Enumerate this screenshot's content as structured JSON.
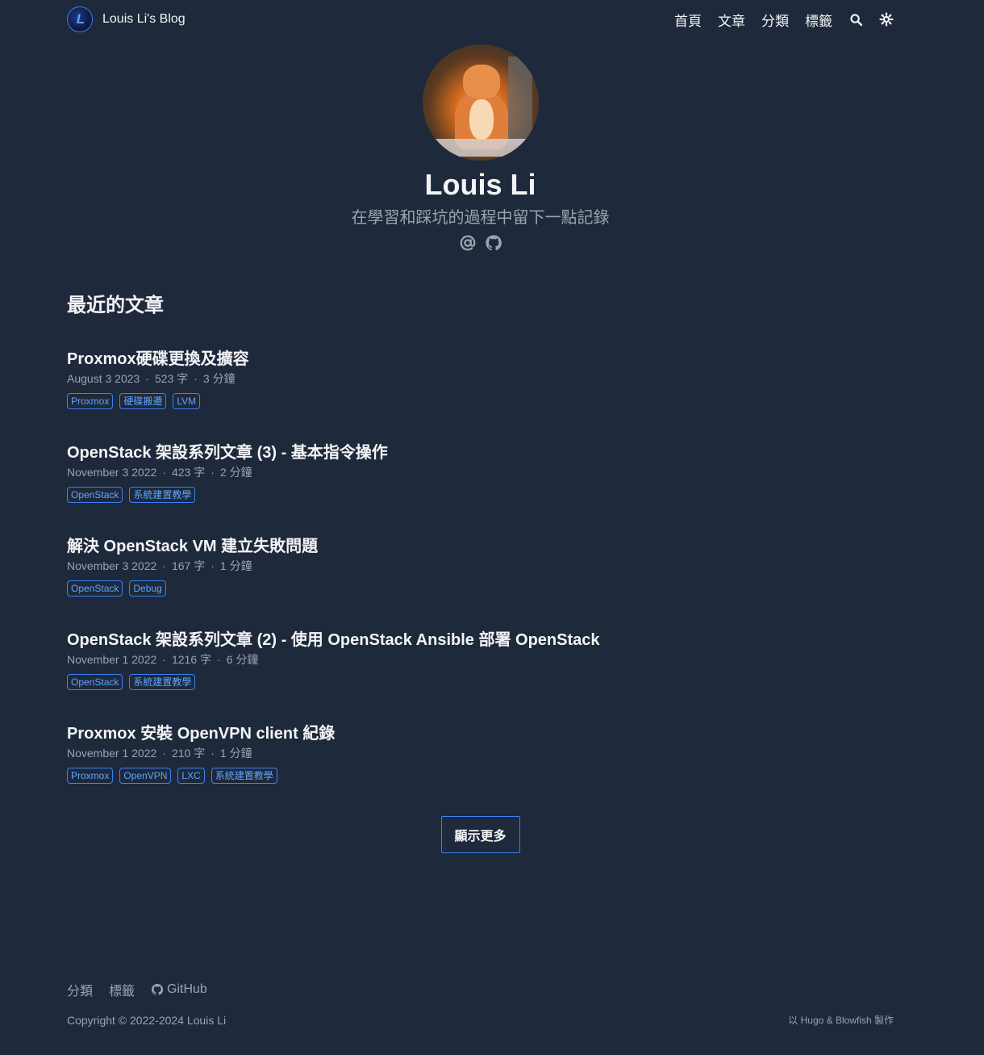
{
  "header": {
    "site_title": "Louis Li's Blog",
    "logo_text": "L",
    "nav": [
      {
        "label": "首頁"
      },
      {
        "label": "文章"
      },
      {
        "label": "分類"
      },
      {
        "label": "標籤"
      }
    ],
    "icons": [
      "search-icon",
      "theme-toggle-icon"
    ]
  },
  "profile": {
    "name": "Louis Li",
    "tagline": "在學習和踩坑的過程中留下一點記錄",
    "social_icons": [
      "email-icon",
      "github-icon"
    ]
  },
  "recent": {
    "heading": "最近的文章",
    "articles": [
      {
        "title": "Proxmox硬碟更換及擴容",
        "date": "August 3 2023",
        "words": "523 字",
        "read": "3 分鐘",
        "tags": [
          "Proxmox",
          "硬碟搬遷",
          "LVM"
        ]
      },
      {
        "title": "OpenStack 架設系列文章 (3) - 基本指令操作",
        "date": "November 3 2022",
        "words": "423 字",
        "read": "2 分鐘",
        "tags": [
          "OpenStack",
          "系統建置教學"
        ]
      },
      {
        "title": "解決 OpenStack VM 建立失敗問題",
        "date": "November 3 2022",
        "words": "167 字",
        "read": "1 分鐘",
        "tags": [
          "OpenStack",
          "Debug"
        ]
      },
      {
        "title": "OpenStack 架設系列文章 (2) - 使用 OpenStack Ansible 部署 OpenStack",
        "date": "November 1 2022",
        "words": "1216 字",
        "read": "6 分鐘",
        "tags": [
          "OpenStack",
          "系統建置教學"
        ]
      },
      {
        "title": "Proxmox 安裝 OpenVPN client 紀錄",
        "date": "November 1 2022",
        "words": "210 字",
        "read": "1 分鐘",
        "tags": [
          "Proxmox",
          "OpenVPN",
          "LXC",
          "系統建置教學"
        ]
      }
    ],
    "more_label": "顯示更多"
  },
  "footer": {
    "links": [
      {
        "label": "分類"
      },
      {
        "label": "標籤"
      },
      {
        "label": "GitHub"
      }
    ],
    "copyright": "Copyright © 2022-2024 Louis Li",
    "powered": "以 Hugo & Blowfish 製作"
  },
  "colors": {
    "background": "#1e293b",
    "accent": "#3b82f6",
    "tag_text": "#60a5fa",
    "muted": "#9ca3af"
  }
}
